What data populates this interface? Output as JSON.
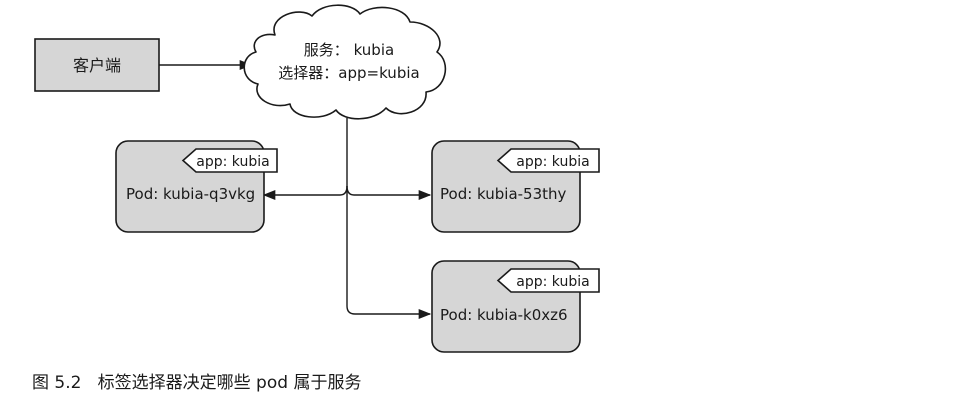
{
  "client": {
    "label": "客户端"
  },
  "service": {
    "name_line": "服务： kubia",
    "selector_line": "选择器：app=kubia"
  },
  "pods": [
    {
      "tag": "app: kubia",
      "name": "Pod: kubia-q3vkg"
    },
    {
      "tag": "app: kubia",
      "name": "Pod: kubia-53thy"
    },
    {
      "tag": "app: kubia",
      "name": "Pod: kubia-k0xz6"
    }
  ],
  "caption": "图 5.2   标签选择器决定哪些 pod 属于服务",
  "colors": {
    "box_fill": "#d6d6d6",
    "stroke": "#1a1a1a",
    "tag_fill": "#ffffff"
  }
}
